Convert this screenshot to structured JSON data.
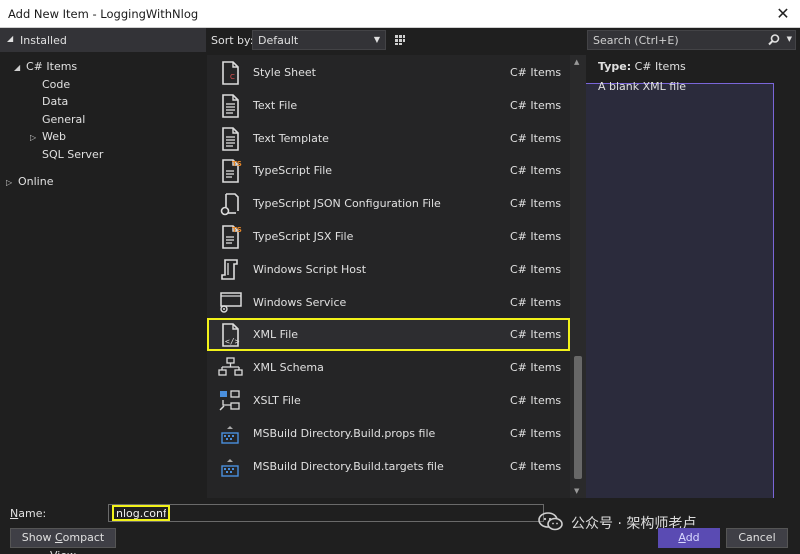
{
  "window": {
    "title": "Add New Item - LoggingWithNlog",
    "close_label": "✕"
  },
  "left": {
    "installed": "Installed",
    "tree": [
      {
        "label": "C# Items",
        "twisty": "◢",
        "indent": 0
      },
      {
        "label": "Code",
        "twisty": "",
        "indent": 1
      },
      {
        "label": "Data",
        "twisty": "",
        "indent": 1
      },
      {
        "label": "General",
        "twisty": "",
        "indent": 1
      },
      {
        "label": "Web",
        "twisty": "▷",
        "indent": 1
      },
      {
        "label": "SQL Server",
        "twisty": "",
        "indent": 1
      }
    ],
    "online": "Online"
  },
  "toolbar": {
    "sort_label": "Sort by:",
    "sort_value": "Default"
  },
  "items": [
    {
      "name": "Style Sheet",
      "category": "C# Items",
      "icon": "css-file-icon"
    },
    {
      "name": "Text File",
      "category": "C# Items",
      "icon": "text-file-icon"
    },
    {
      "name": "Text Template",
      "category": "C# Items",
      "icon": "text-template-icon"
    },
    {
      "name": "TypeScript File",
      "category": "C# Items",
      "icon": "typescript-file-icon"
    },
    {
      "name": "TypeScript JSON Configuration File",
      "category": "C# Items",
      "icon": "json-config-icon"
    },
    {
      "name": "TypeScript JSX File",
      "category": "C# Items",
      "icon": "typescript-jsx-icon"
    },
    {
      "name": "Windows Script Host",
      "category": "C# Items",
      "icon": "script-host-icon"
    },
    {
      "name": "Windows Service",
      "category": "C# Items",
      "icon": "windows-service-icon"
    },
    {
      "name": "XML File",
      "category": "C# Items",
      "icon": "xml-file-icon",
      "selected": true
    },
    {
      "name": "XML Schema",
      "category": "C# Items",
      "icon": "xml-schema-icon"
    },
    {
      "name": "XSLT File",
      "category": "C# Items",
      "icon": "xslt-file-icon"
    },
    {
      "name": "MSBuild Directory.Build.props file",
      "category": "C# Items",
      "icon": "msbuild-props-icon"
    },
    {
      "name": "MSBuild Directory.Build.targets file",
      "category": "C# Items",
      "icon": "msbuild-targets-icon"
    }
  ],
  "search": {
    "placeholder": "Search (Ctrl+E)"
  },
  "details": {
    "type_label": "Type:",
    "type_value": "C# Items",
    "description": "A blank XML file"
  },
  "bottom": {
    "name_label_pre": "",
    "name_label_ul": "N",
    "name_label_post": "ame:",
    "name_value": "nlog.config",
    "compact_pre": "Show ",
    "compact_ul": "C",
    "compact_post": "ompact View",
    "add_pre": "",
    "add_ul": "A",
    "add_post": "dd",
    "cancel": "Cancel"
  },
  "watermark": {
    "text": "公众号 · 架构师老卢"
  },
  "colors": {
    "highlight": "#f2f21a",
    "accent": "#7a66d9",
    "add_button": "#5a4bb3"
  }
}
